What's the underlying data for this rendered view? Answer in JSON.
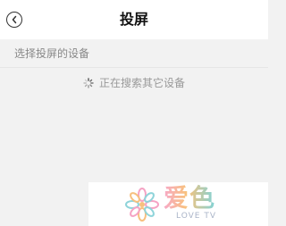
{
  "header": {
    "title": "投屏",
    "back_icon": "chevron-left-circle-icon"
  },
  "section": {
    "label": "选择投屏的设备"
  },
  "status": {
    "icon": "loading-spinner-icon",
    "text": "正在搜索其它设备"
  },
  "watermark": {
    "logo_text": "爱色",
    "sub_text": "LOVE TV",
    "icon": "flower-logo-icon"
  },
  "colors": {
    "background": "#f2f2f2",
    "header": "#ffffff",
    "title": "#111111",
    "muted_text": "#888888"
  }
}
